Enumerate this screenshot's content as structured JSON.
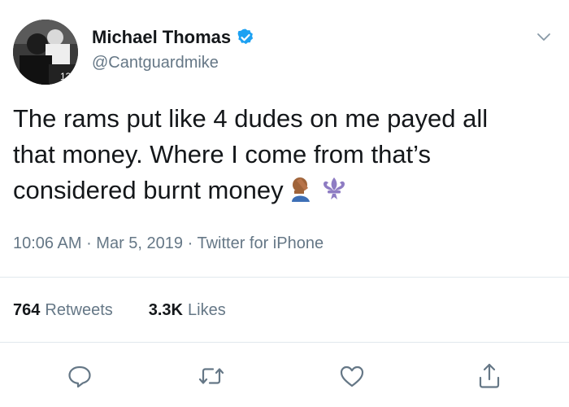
{
  "user": {
    "display_name": "Michael Thomas",
    "handle": "@Cantguardmike",
    "verified": true
  },
  "tweet": {
    "text": "The rams put like 4 dudes on me payed all\nthat money. Where I come from that’s\nconsidered burnt money",
    "emojis": [
      "face-palm-emoji",
      "fleur-de-lis-emoji"
    ],
    "time": "10:06 AM",
    "date": "Mar 5, 2019",
    "separator": " · ",
    "source": "Twitter for iPhone"
  },
  "stats": {
    "retweets_count": "764",
    "retweets_label": "Retweets",
    "likes_count": "3.3K",
    "likes_label": "Likes"
  },
  "actions": [
    "reply-icon",
    "retweet-icon",
    "like-icon",
    "share-icon"
  ],
  "colors": {
    "text": "#14171a",
    "secondary": "#657786",
    "verified": "#1da1f2",
    "divider": "#e1e8ed",
    "fleur": "#8e7cc3"
  }
}
